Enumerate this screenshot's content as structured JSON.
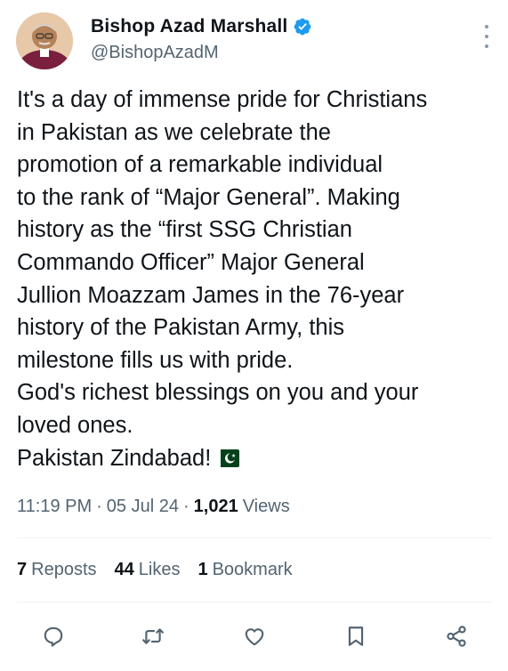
{
  "author": {
    "name": "Bishop Azad Marshall",
    "handle": "@BishopAzadM",
    "verified_color": "#1d9bf0"
  },
  "tweet": {
    "text": "It's a day of immense pride for Christians\nin Pakistan as we celebrate the\npromotion of a remarkable individual\nto the rank of “Major General”. Making\nhistory as the “first SSG Christian\nCommando Officer” Major General\nJullion Moazzam James in the 76-year\nhistory of the Pakistan Army, this\nmilestone fills us with pride.\nGod's richest blessings on you and your\nloved ones.\nPakistan Zindabad!",
    "flag_emoji": "pakistan-flag-icon"
  },
  "meta": {
    "time": "11:19 PM",
    "separator": "·",
    "date": "05 Jul 24",
    "views_count": "1,021",
    "views_label": "Views"
  },
  "stats": {
    "reposts_count": "7",
    "reposts_label": "Reposts",
    "likes_count": "44",
    "likes_label": "Likes",
    "bookmarks_count": "1",
    "bookmarks_label": "Bookmark"
  },
  "actions": [
    "reply-icon",
    "repost-icon",
    "like-icon",
    "bookmark-icon",
    "share-icon"
  ],
  "colors": {
    "text": "#0f1419",
    "secondary": "#536471",
    "divider": "#eff3f4",
    "accent": "#1d9bf0"
  }
}
